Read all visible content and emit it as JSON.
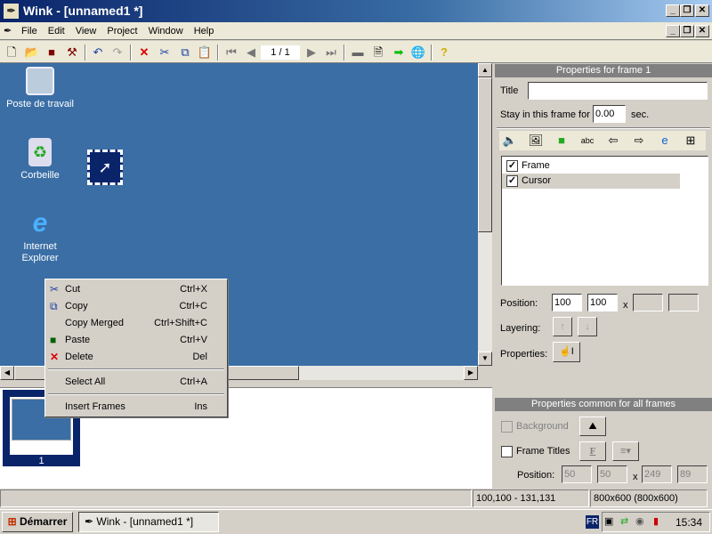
{
  "window": {
    "title": "Wink - [unnamed1 *]",
    "controls": [
      "_",
      "❐",
      "✕"
    ]
  },
  "menu": [
    "File",
    "Edit",
    "View",
    "Project",
    "Window",
    "Help"
  ],
  "toolbar": {
    "page_indicator": "1 / 1"
  },
  "desktop": {
    "icons": [
      {
        "label": "Poste de travail"
      },
      {
        "label": "Corbeille"
      },
      {
        "label": "Internet Explorer"
      }
    ]
  },
  "context_menu": {
    "items": [
      {
        "label": "Cut",
        "shortcut": "Ctrl+X",
        "icon": "scissors-icon"
      },
      {
        "label": "Copy",
        "shortcut": "Ctrl+C",
        "icon": "copy-icon"
      },
      {
        "label": "Copy Merged",
        "shortcut": "Ctrl+Shift+C",
        "icon": ""
      },
      {
        "label": "Paste",
        "shortcut": "Ctrl+V",
        "icon": "paste-icon"
      },
      {
        "label": "Delete",
        "shortcut": "Del",
        "icon": "delete-icon"
      },
      {
        "label": "Select All",
        "shortcut": "Ctrl+A",
        "icon": ""
      },
      {
        "label": "Insert Frames",
        "shortcut": "Ins",
        "icon": ""
      }
    ]
  },
  "filmstrip": {
    "frames": [
      {
        "number": "1"
      }
    ]
  },
  "frame_props": {
    "header": "Properties for frame 1",
    "title_label": "Title",
    "title_value": "",
    "stay_label": "Stay in this frame for",
    "stay_value": "0.00",
    "stay_unit": "sec.",
    "items": [
      {
        "label": "Frame",
        "checked": true
      },
      {
        "label": "Cursor",
        "checked": true
      }
    ],
    "position_label": "Position:",
    "pos_x": "100",
    "pos_y": "100",
    "x_sep": "x",
    "layering_label": "Layering:",
    "properties_label": "Properties:"
  },
  "common_props": {
    "header": "Properties common for all frames",
    "background_label": "Background",
    "frame_titles_label": "Frame Titles",
    "font_button": "F",
    "position_label": "Position:",
    "pos": [
      "50",
      "50",
      "249",
      "89"
    ],
    "x_sep": "x"
  },
  "statusbar": {
    "left": "",
    "coords": "100,100 - 131,131",
    "size": "800x600 (800x600)"
  },
  "taskbar": {
    "start": "Démarrer",
    "task": "Wink - [unnamed1 *]",
    "lang": "FR",
    "clock": "15:34"
  },
  "colors": {
    "desktop": "#3a6ea5",
    "selection": "#0a246a"
  }
}
